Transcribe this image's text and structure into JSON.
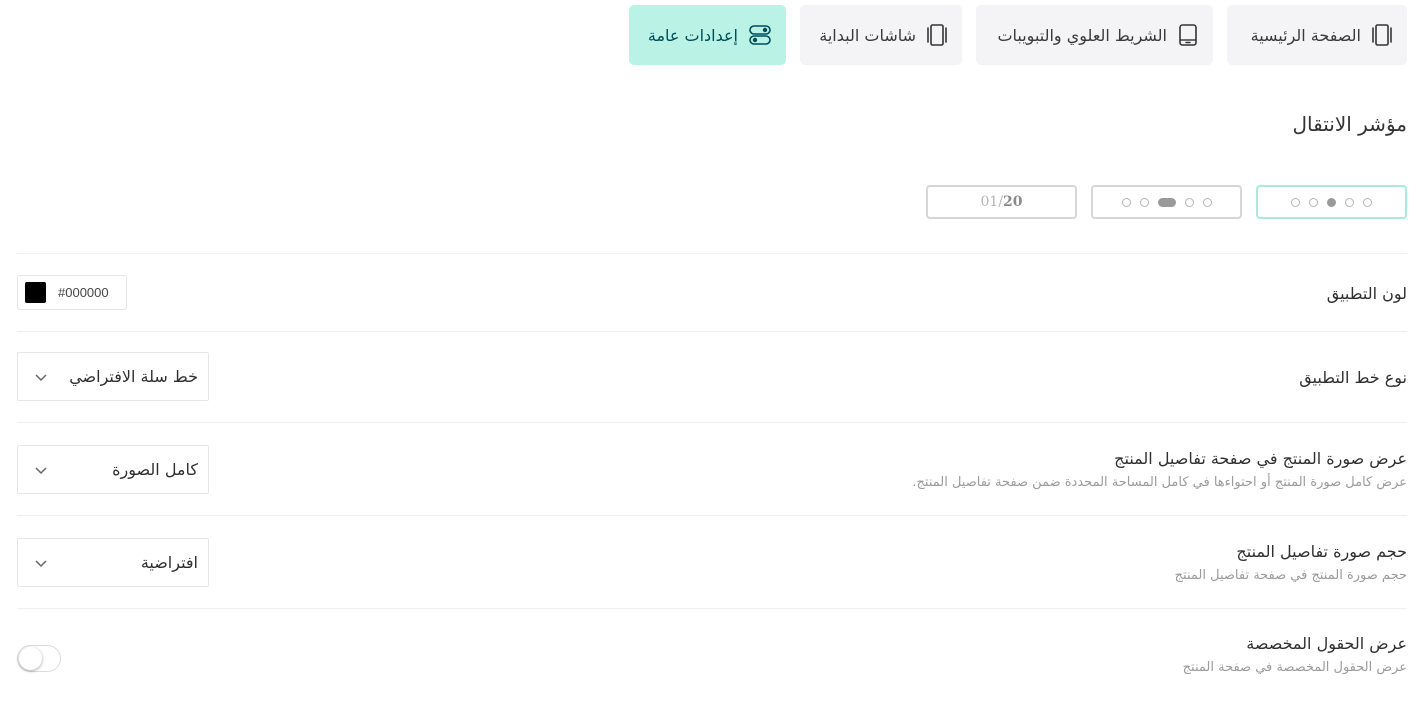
{
  "tabs": [
    {
      "label": "الصفحة الرئيسية",
      "icon": "tablet-frame-icon"
    },
    {
      "label": "الشريط العلوي والتبويبات",
      "icon": "tablet-icon"
    },
    {
      "label": "شاشات البداية",
      "icon": "tablet-frame-icon"
    },
    {
      "label": "إعدادات عامة",
      "icon": "toggles-icon",
      "active": true
    }
  ],
  "transition_indicator": {
    "title": "مؤشر الانتقال",
    "options": [
      {
        "style": "dots",
        "selected": true
      },
      {
        "style": "pill-dots"
      },
      {
        "style": "counter",
        "current": "20",
        "total": "01"
      }
    ]
  },
  "app_color": {
    "label": "لون التطبيق",
    "value": "#000000",
    "swatch": "#000000"
  },
  "app_font": {
    "label": "نوع خط التطبيق",
    "value": "خط سلة الافتراضي"
  },
  "product_image_display": {
    "label": "عرض صورة المنتج في صفحة تفاصيل المنتج",
    "description": "عرض كامل صورة المنتج أو احتواءها في كامل المساحة المحددة ضمن صفحة تفاصيل المنتج.",
    "value": "كامل الصورة"
  },
  "product_image_size": {
    "label": "حجم صورة تفاصيل المنتج",
    "description": "حجم صورة المنتج في صفحة تفاصيل المنتج",
    "value": "افتراضية"
  },
  "custom_fields": {
    "label": "عرض الحقول المخصصة",
    "description": "عرض الحقول المخصصة في صفحة المنتج",
    "enabled": false
  },
  "colors": {
    "accent_bg": "#baf3e6",
    "accent_text": "#004d5a",
    "tab_bg": "#f4f4f6"
  }
}
